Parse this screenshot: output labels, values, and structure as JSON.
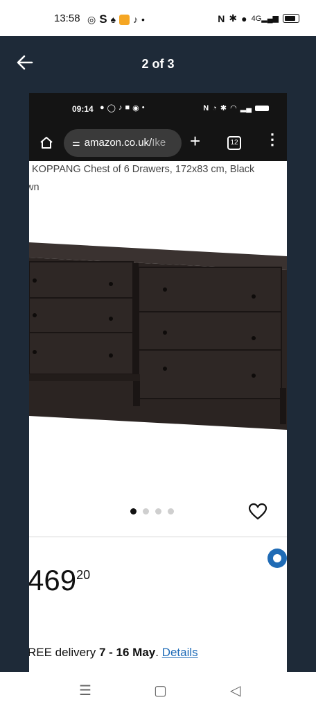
{
  "status_bar": {
    "time": "13:58",
    "network": "4G"
  },
  "viewer": {
    "counter": "2 of 3"
  },
  "inner": {
    "status_time": "09:14",
    "url_host": "amazon.co.uk/",
    "url_path": "Ike",
    "tab_count": "12",
    "title_line1": "KOPPANG Chest of 6 Drawers, 172x83 cm, Black",
    "title_line2": "wn",
    "price_main": "469",
    "price_fraction": "20",
    "delivery_prefix": "REE delivery ",
    "delivery_dates": "7 - 16 May",
    "delivery_sep": ". ",
    "delivery_link": "Details"
  },
  "colors": {
    "viewer_bg": "#1e2a38",
    "link": "#1e6bb8",
    "product": "#2b2422"
  }
}
